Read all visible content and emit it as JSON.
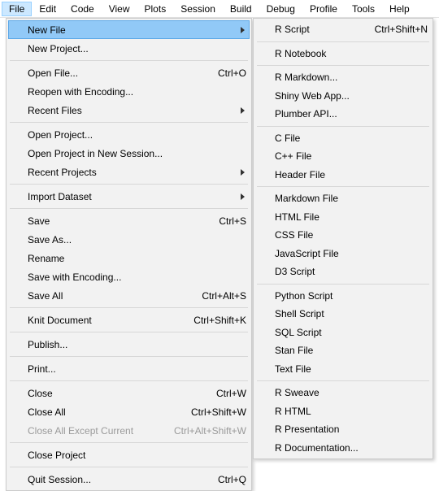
{
  "menubar": [
    "File",
    "Edit",
    "Code",
    "View",
    "Plots",
    "Session",
    "Build",
    "Debug",
    "Profile",
    "Tools",
    "Help"
  ],
  "fileMenu": [
    {
      "t": "item",
      "label": "New File",
      "arrow": true,
      "hl": true
    },
    {
      "t": "item",
      "label": "New Project..."
    },
    {
      "t": "sep"
    },
    {
      "t": "item",
      "label": "Open File...",
      "sc": "Ctrl+O"
    },
    {
      "t": "item",
      "label": "Reopen with Encoding..."
    },
    {
      "t": "item",
      "label": "Recent Files",
      "arrow": true
    },
    {
      "t": "sep"
    },
    {
      "t": "item",
      "label": "Open Project..."
    },
    {
      "t": "item",
      "label": "Open Project in New Session..."
    },
    {
      "t": "item",
      "label": "Recent Projects",
      "arrow": true
    },
    {
      "t": "sep"
    },
    {
      "t": "item",
      "label": "Import Dataset",
      "arrow": true
    },
    {
      "t": "sep"
    },
    {
      "t": "item",
      "label": "Save",
      "sc": "Ctrl+S"
    },
    {
      "t": "item",
      "label": "Save As..."
    },
    {
      "t": "item",
      "label": "Rename"
    },
    {
      "t": "item",
      "label": "Save with Encoding..."
    },
    {
      "t": "item",
      "label": "Save All",
      "sc": "Ctrl+Alt+S"
    },
    {
      "t": "sep"
    },
    {
      "t": "item",
      "label": "Knit Document",
      "sc": "Ctrl+Shift+K"
    },
    {
      "t": "sep"
    },
    {
      "t": "item",
      "label": "Publish..."
    },
    {
      "t": "sep"
    },
    {
      "t": "item",
      "label": "Print..."
    },
    {
      "t": "sep"
    },
    {
      "t": "item",
      "label": "Close",
      "sc": "Ctrl+W"
    },
    {
      "t": "item",
      "label": "Close All",
      "sc": "Ctrl+Shift+W"
    },
    {
      "t": "item",
      "label": "Close All Except Current",
      "sc": "Ctrl+Alt+Shift+W",
      "disabled": true
    },
    {
      "t": "sep"
    },
    {
      "t": "item",
      "label": "Close Project"
    },
    {
      "t": "sep"
    },
    {
      "t": "item",
      "label": "Quit Session...",
      "sc": "Ctrl+Q"
    }
  ],
  "newFileMenu": [
    {
      "t": "item",
      "label": "R Script",
      "sc": "Ctrl+Shift+N"
    },
    {
      "t": "sep"
    },
    {
      "t": "item",
      "label": "R Notebook"
    },
    {
      "t": "sep"
    },
    {
      "t": "item",
      "label": "R Markdown..."
    },
    {
      "t": "item",
      "label": "Shiny Web App..."
    },
    {
      "t": "item",
      "label": "Plumber API..."
    },
    {
      "t": "sep"
    },
    {
      "t": "item",
      "label": "C File"
    },
    {
      "t": "item",
      "label": "C++ File"
    },
    {
      "t": "item",
      "label": "Header File"
    },
    {
      "t": "sep"
    },
    {
      "t": "item",
      "label": "Markdown File"
    },
    {
      "t": "item",
      "label": "HTML File"
    },
    {
      "t": "item",
      "label": "CSS File"
    },
    {
      "t": "item",
      "label": "JavaScript File"
    },
    {
      "t": "item",
      "label": "D3 Script"
    },
    {
      "t": "sep"
    },
    {
      "t": "item",
      "label": "Python Script"
    },
    {
      "t": "item",
      "label": "Shell Script"
    },
    {
      "t": "item",
      "label": "SQL Script"
    },
    {
      "t": "item",
      "label": "Stan File"
    },
    {
      "t": "item",
      "label": "Text File"
    },
    {
      "t": "sep"
    },
    {
      "t": "item",
      "label": "R Sweave"
    },
    {
      "t": "item",
      "label": "R HTML"
    },
    {
      "t": "item",
      "label": "R Presentation"
    },
    {
      "t": "item",
      "label": "R Documentation..."
    }
  ]
}
